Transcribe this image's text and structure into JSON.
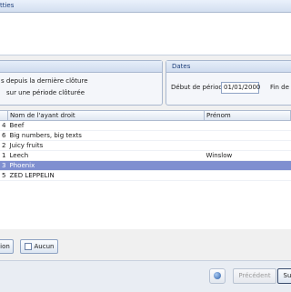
{
  "header": {
    "title": "tties"
  },
  "closure": {
    "option_since_last": "s depuis la dernière clôture",
    "option_on_period": "sur une période clôturée"
  },
  "dates": {
    "title": "Dates",
    "start_label": "Début de période",
    "start_value": "01/01/2000",
    "end_label": "Fin de p"
  },
  "table": {
    "columns": {
      "name": "Nom de l'ayant droit",
      "firstname": "Prénom"
    },
    "rows": [
      {
        "num": "4",
        "name": "Beef",
        "firstname": ""
      },
      {
        "num": "6",
        "name": "Big numbers, big texts",
        "firstname": ""
      },
      {
        "num": "2",
        "name": "Juicy fruits",
        "firstname": ""
      },
      {
        "num": "1",
        "name": "Leech",
        "firstname": "Winslow"
      },
      {
        "num": "3",
        "name": "Phoenix",
        "firstname": ""
      },
      {
        "num": "5",
        "name": "ZED LEPPELIN",
        "firstname": ""
      }
    ]
  },
  "selection": {
    "all_label": "ion",
    "none_label": "Aucun"
  },
  "footer": {
    "previous_label": "Précédent",
    "next_label": "Su"
  }
}
